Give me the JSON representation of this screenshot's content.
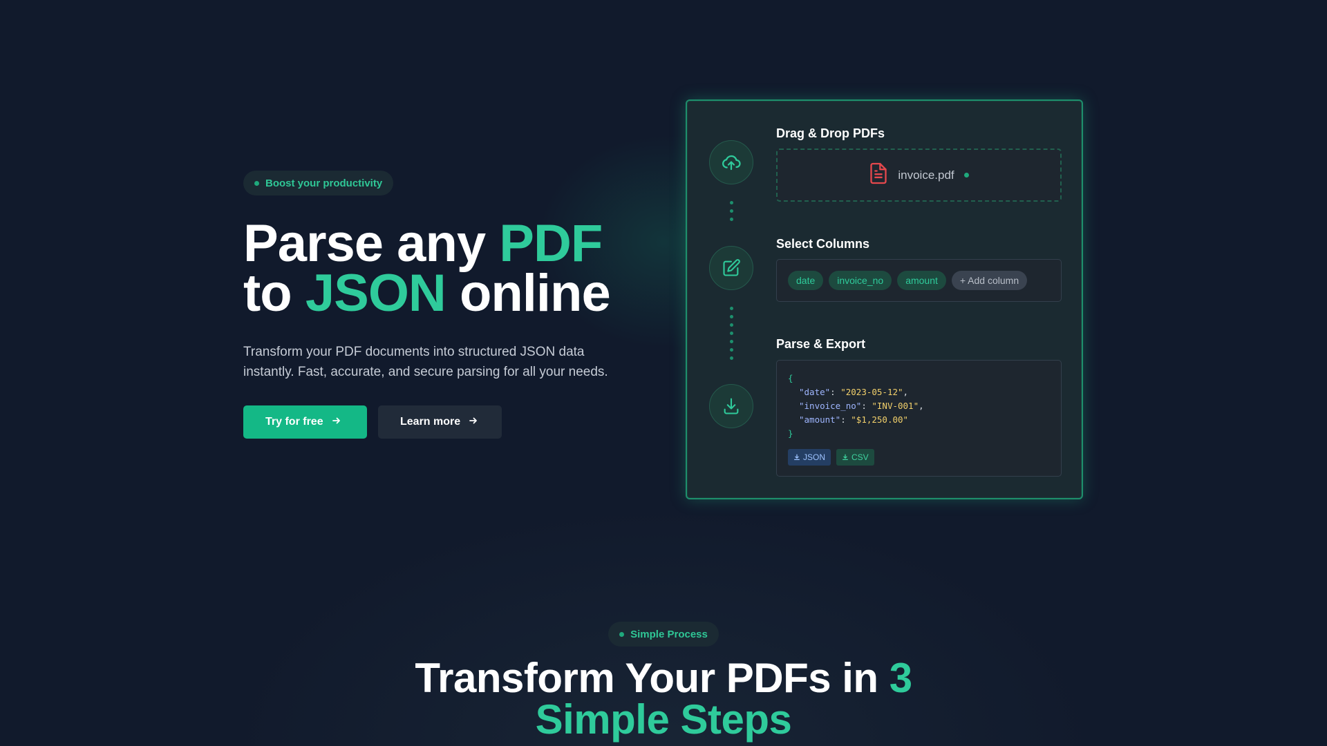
{
  "hero": {
    "badge": "Boost your productivity",
    "title_part1": "Parse any ",
    "title_accent1": "PDF",
    "title_part2": "to ",
    "title_accent2": "JSON",
    "title_part3": " online",
    "subtitle": "Transform your PDF documents into structured JSON data instantly. Fast, accurate, and secure parsing for all your needs.",
    "cta_primary": "Try for free",
    "cta_secondary": "Learn more"
  },
  "card": {
    "step1_title": "Drag & Drop PDFs",
    "file_name": "invoice.pdf",
    "step2_title": "Select Columns",
    "columns": [
      "date",
      "invoice_no",
      "amount"
    ],
    "add_column": "+ Add column",
    "step3_title": "Parse & Export",
    "json_lines": [
      {
        "key": "\"date\"",
        "value": "\"2023-05-12\""
      },
      {
        "key": "\"invoice_no\"",
        "value": "\"INV-001\""
      },
      {
        "key": "\"amount\"",
        "value": "\"$1,250.00\""
      }
    ],
    "export_json": "JSON",
    "export_csv": "CSV"
  },
  "process": {
    "badge": "Simple Process",
    "title_part1": "Transform Your PDFs in ",
    "title_accent": "3",
    "title_line2": "Simple Steps"
  },
  "colors": {
    "accent": "#2fcb9b",
    "primary_button": "#14b886",
    "background": "#111a2c",
    "file_icon": "#e5484d"
  },
  "icons": [
    "upload-cloud-icon",
    "edit-icon",
    "download-icon",
    "file-text-icon",
    "arrow-right-icon"
  ]
}
